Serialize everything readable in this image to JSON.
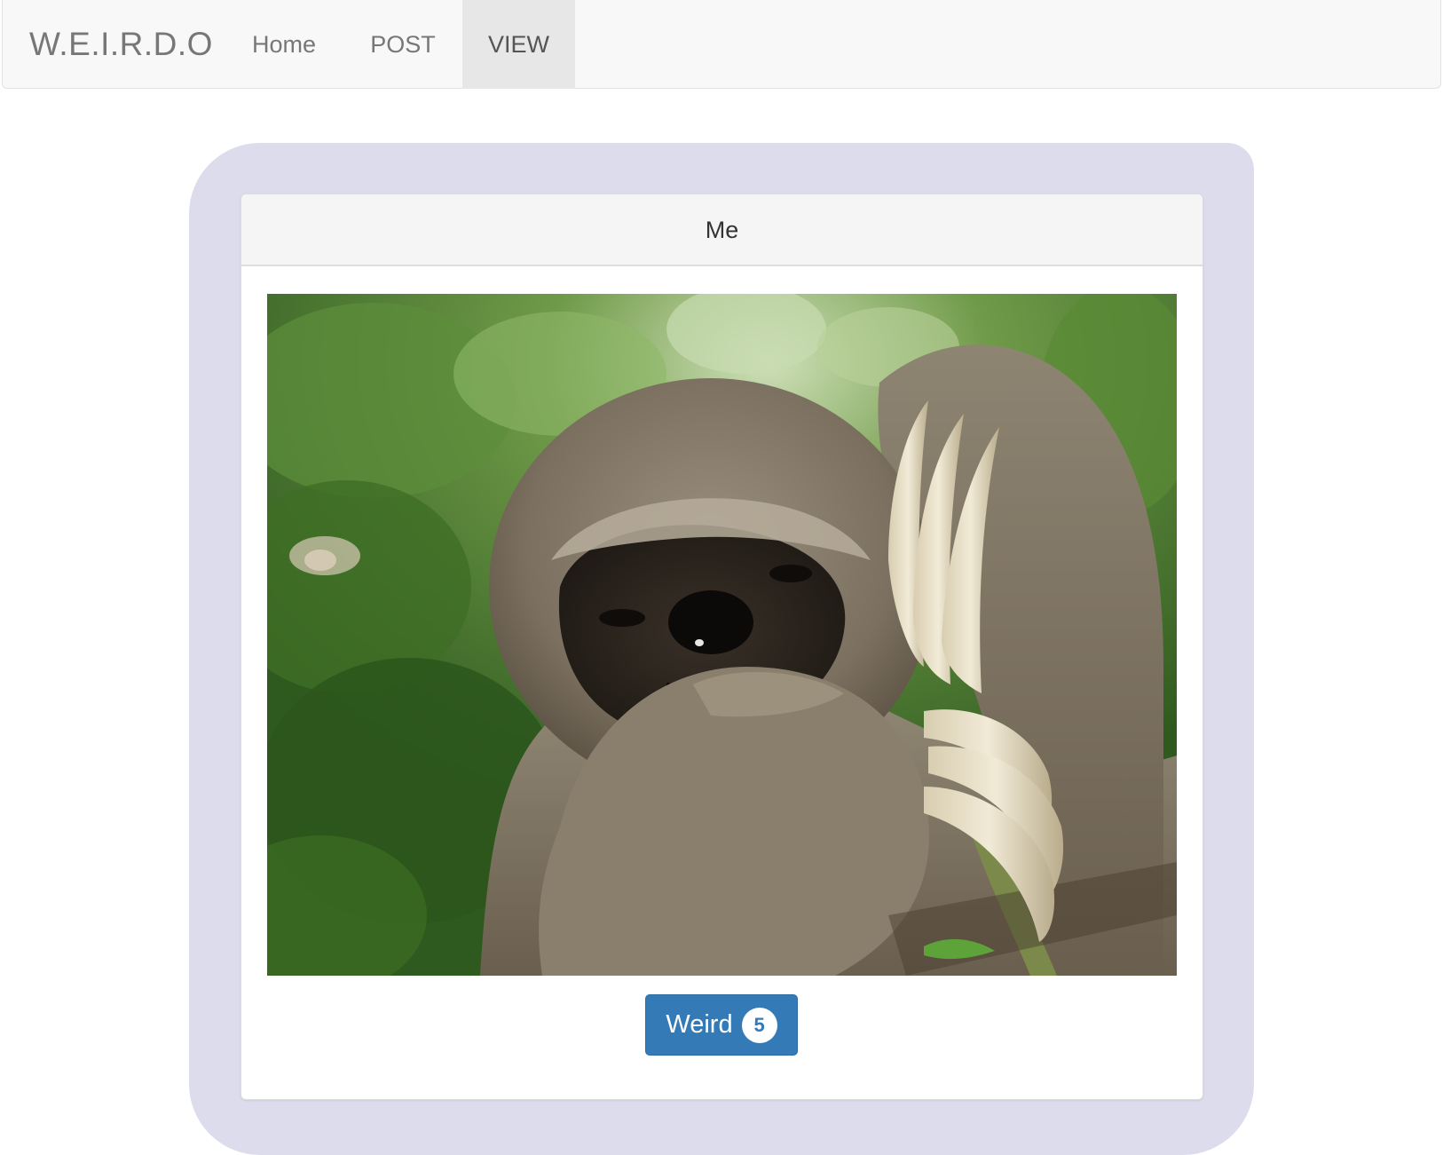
{
  "navbar": {
    "brand": "W.E.I.R.D.O",
    "items": [
      {
        "label": "Home",
        "active": false
      },
      {
        "label": "POST",
        "active": false
      },
      {
        "label": "VIEW",
        "active": true
      }
    ]
  },
  "post": {
    "title": "Me",
    "weird_button_label": "Weird",
    "weird_count": "5"
  },
  "colors": {
    "navbar_bg": "#f8f8f8",
    "active_tab_bg": "#e7e7e7",
    "frame_bg": "#dddcec",
    "button_primary": "#337ab7"
  }
}
